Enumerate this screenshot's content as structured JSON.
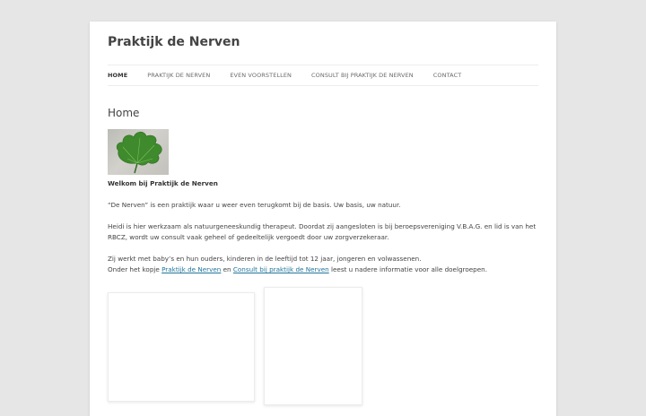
{
  "site": {
    "title": "Praktijk de Nerven"
  },
  "nav": {
    "items": [
      {
        "label": "HOME"
      },
      {
        "label": "PRAKTIJK DE NERVEN"
      },
      {
        "label": "EVEN VOORSTELLEN"
      },
      {
        "label": "CONSULT BIJ PRAKTIJK DE NERVEN"
      },
      {
        "label": "CONTACT"
      }
    ]
  },
  "main": {
    "title": "Home",
    "welcome": "Welkom bij Praktijk de Nerven",
    "p1": "“De Nerven” is een praktijk waar u weer even terugkomt bij de basis. Uw basis, uw natuur.",
    "p2": "Heidi is hier werkzaam als natuurgeneeskundig therapeut. Doordat zij aangesloten is bij beroepsvereniging V.B.A.G. en lid is van het RBCZ, wordt uw consult vaak geheel of gedeeltelijk vergoedt door uw zorgverzekeraar.",
    "p3_line1": "Zij werkt met baby’s en hun ouders, kinderen in de leeftijd tot 12 jaar, jongeren en volwassenen.",
    "p3_pre": "Onder het kopje ",
    "p3_link1": "Praktijk de Nerven",
    "p3_mid": " en ",
    "p3_link2": "Consult bij praktijk de Nerven",
    "p3_post": " leest u nadere informatie voor alle doelgroepen."
  },
  "colors": {
    "background": "#e6e6e6",
    "link": "#21759b",
    "leaf": "#3e8a2c"
  }
}
